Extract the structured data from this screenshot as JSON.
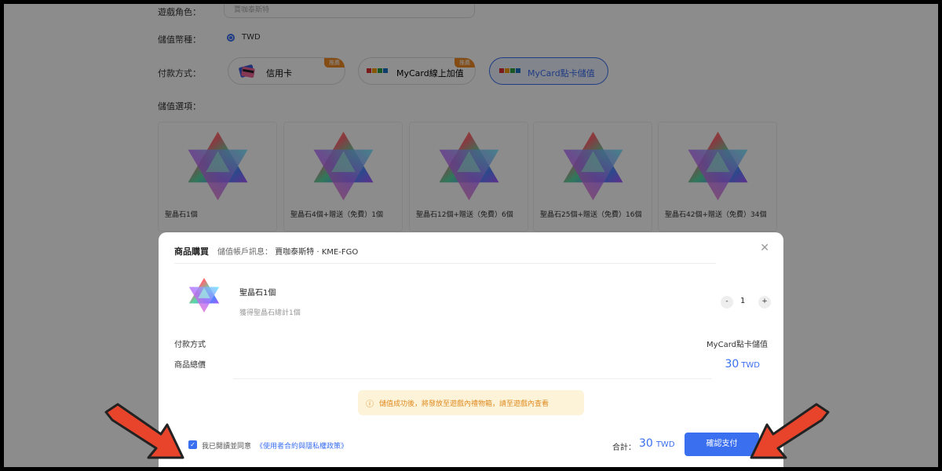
{
  "form": {
    "role_label": "遊戲角色：",
    "role_value": "賈咖泰斯特",
    "currency_label": "儲值幣種：",
    "currency_value": "TWD",
    "payment_label": "付款方式：",
    "options_label": "儲值選項："
  },
  "payment_methods": [
    {
      "label": "信用卡",
      "tag": "推薦",
      "icon": "credit-card-icon"
    },
    {
      "label": "MyCard線上加值",
      "tag": "推薦",
      "icon": "mycard-logo-icon"
    },
    {
      "label": "MyCard點卡儲值",
      "tag": "",
      "icon": "mycard-logo-icon"
    }
  ],
  "products": [
    {
      "name": "聖晶石1個"
    },
    {
      "name": "聖晶石4個+贈送（免費）1個"
    },
    {
      "name": "聖晶石12個+贈送（免費）6個"
    },
    {
      "name": "聖晶石25個+贈送（免費）16個"
    },
    {
      "name": "聖晶石42個+贈送（免費）34個"
    }
  ],
  "modal": {
    "title": "商品購買",
    "account_label": "儲值帳戶訊息：",
    "account_value": "賈咖泰斯特 · KME-FGO",
    "product_name": "聖晶石1個",
    "product_sub": "獲得聖晶石總計1個",
    "qty_minus": "-",
    "qty_value": "1",
    "qty_plus": "+",
    "pay_method_label": "付款方式",
    "pay_method_value": "MyCard點卡儲值",
    "total_label": "商品總價",
    "total_amount": "30",
    "total_unit": "TWD",
    "notice_icon": "ⓘ",
    "notice": "儲值成功後，將發放至遊戲內禮物箱，請至遊戲內查看",
    "agree_text": "我已閱讀並同意",
    "agree_link": "《使用者合約與隱私權政策》",
    "sum_label": "合計：",
    "sum_amount": "30",
    "sum_unit": "TWD",
    "confirm": "確認支付",
    "close": "✕"
  },
  "colors": {
    "accent": "#3a6ff0",
    "tag": "#f08a24",
    "arrow": "#e8442b"
  }
}
